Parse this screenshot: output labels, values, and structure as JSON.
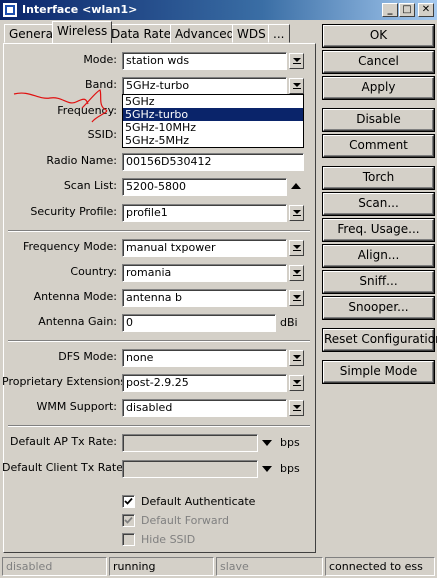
{
  "window": {
    "title": "Interface <wlan1>",
    "min_label": "_",
    "max_label": "□",
    "close_label": "✕"
  },
  "tabs": [
    "General",
    "Wireless",
    "Data Rates",
    "Advanced",
    "WDS",
    "..."
  ],
  "form": {
    "mode": {
      "label": "Mode:",
      "value": "station wds"
    },
    "band": {
      "label": "Band:",
      "value": "5GHz-turbo",
      "options": [
        "5GHz",
        "5GHz-turbo",
        "5GHz-10MHz",
        "5GHz-5MHz"
      ],
      "selected_index": 1
    },
    "frequency": {
      "label": "Frequency:"
    },
    "ssid": {
      "label": "SSID:"
    },
    "radio_name": {
      "label": "Radio Name:",
      "value": "00156D530412"
    },
    "scan_list": {
      "label": "Scan List:",
      "value": "5200-5800"
    },
    "security_profile": {
      "label": "Security Profile:",
      "value": "profile1"
    },
    "frequency_mode": {
      "label": "Frequency Mode:",
      "value": "manual txpower"
    },
    "country": {
      "label": "Country:",
      "value": "romania"
    },
    "antenna_mode": {
      "label": "Antenna Mode:",
      "value": "antenna b"
    },
    "antenna_gain": {
      "label": "Antenna Gain:",
      "value": "0",
      "unit": "dBi"
    },
    "dfs_mode": {
      "label": "DFS Mode:",
      "value": "none"
    },
    "proprietary_extensions": {
      "label": "Proprietary Extensions:",
      "value": "post-2.9.25"
    },
    "wmm_support": {
      "label": "WMM Support:",
      "value": "disabled"
    },
    "default_ap_tx_rate": {
      "label": "Default AP Tx Rate:",
      "value": "",
      "unit": "bps"
    },
    "default_client_tx_rate": {
      "label": "Default Client Tx Rate:",
      "value": "",
      "unit": "bps"
    },
    "default_authenticate": {
      "label": "Default Authenticate",
      "checked": true,
      "enabled": true
    },
    "default_forward": {
      "label": "Default Forward",
      "checked": true,
      "enabled": false
    },
    "hide_ssid": {
      "label": "Hide SSID",
      "checked": false,
      "enabled": false
    }
  },
  "buttons": [
    "OK",
    "Cancel",
    "Apply",
    "Disable",
    "Comment",
    "Torch",
    "Scan...",
    "Freq. Usage...",
    "Align...",
    "Sniff...",
    "Snooper...",
    "Reset Configuration",
    "Simple Mode"
  ],
  "status": [
    "disabled",
    "running",
    "slave",
    "connected to ess"
  ],
  "colors": {
    "title_start": "#0a246a",
    "title_end": "#a6caf0",
    "selection": "#0a246a",
    "annotation": "#e01010"
  }
}
